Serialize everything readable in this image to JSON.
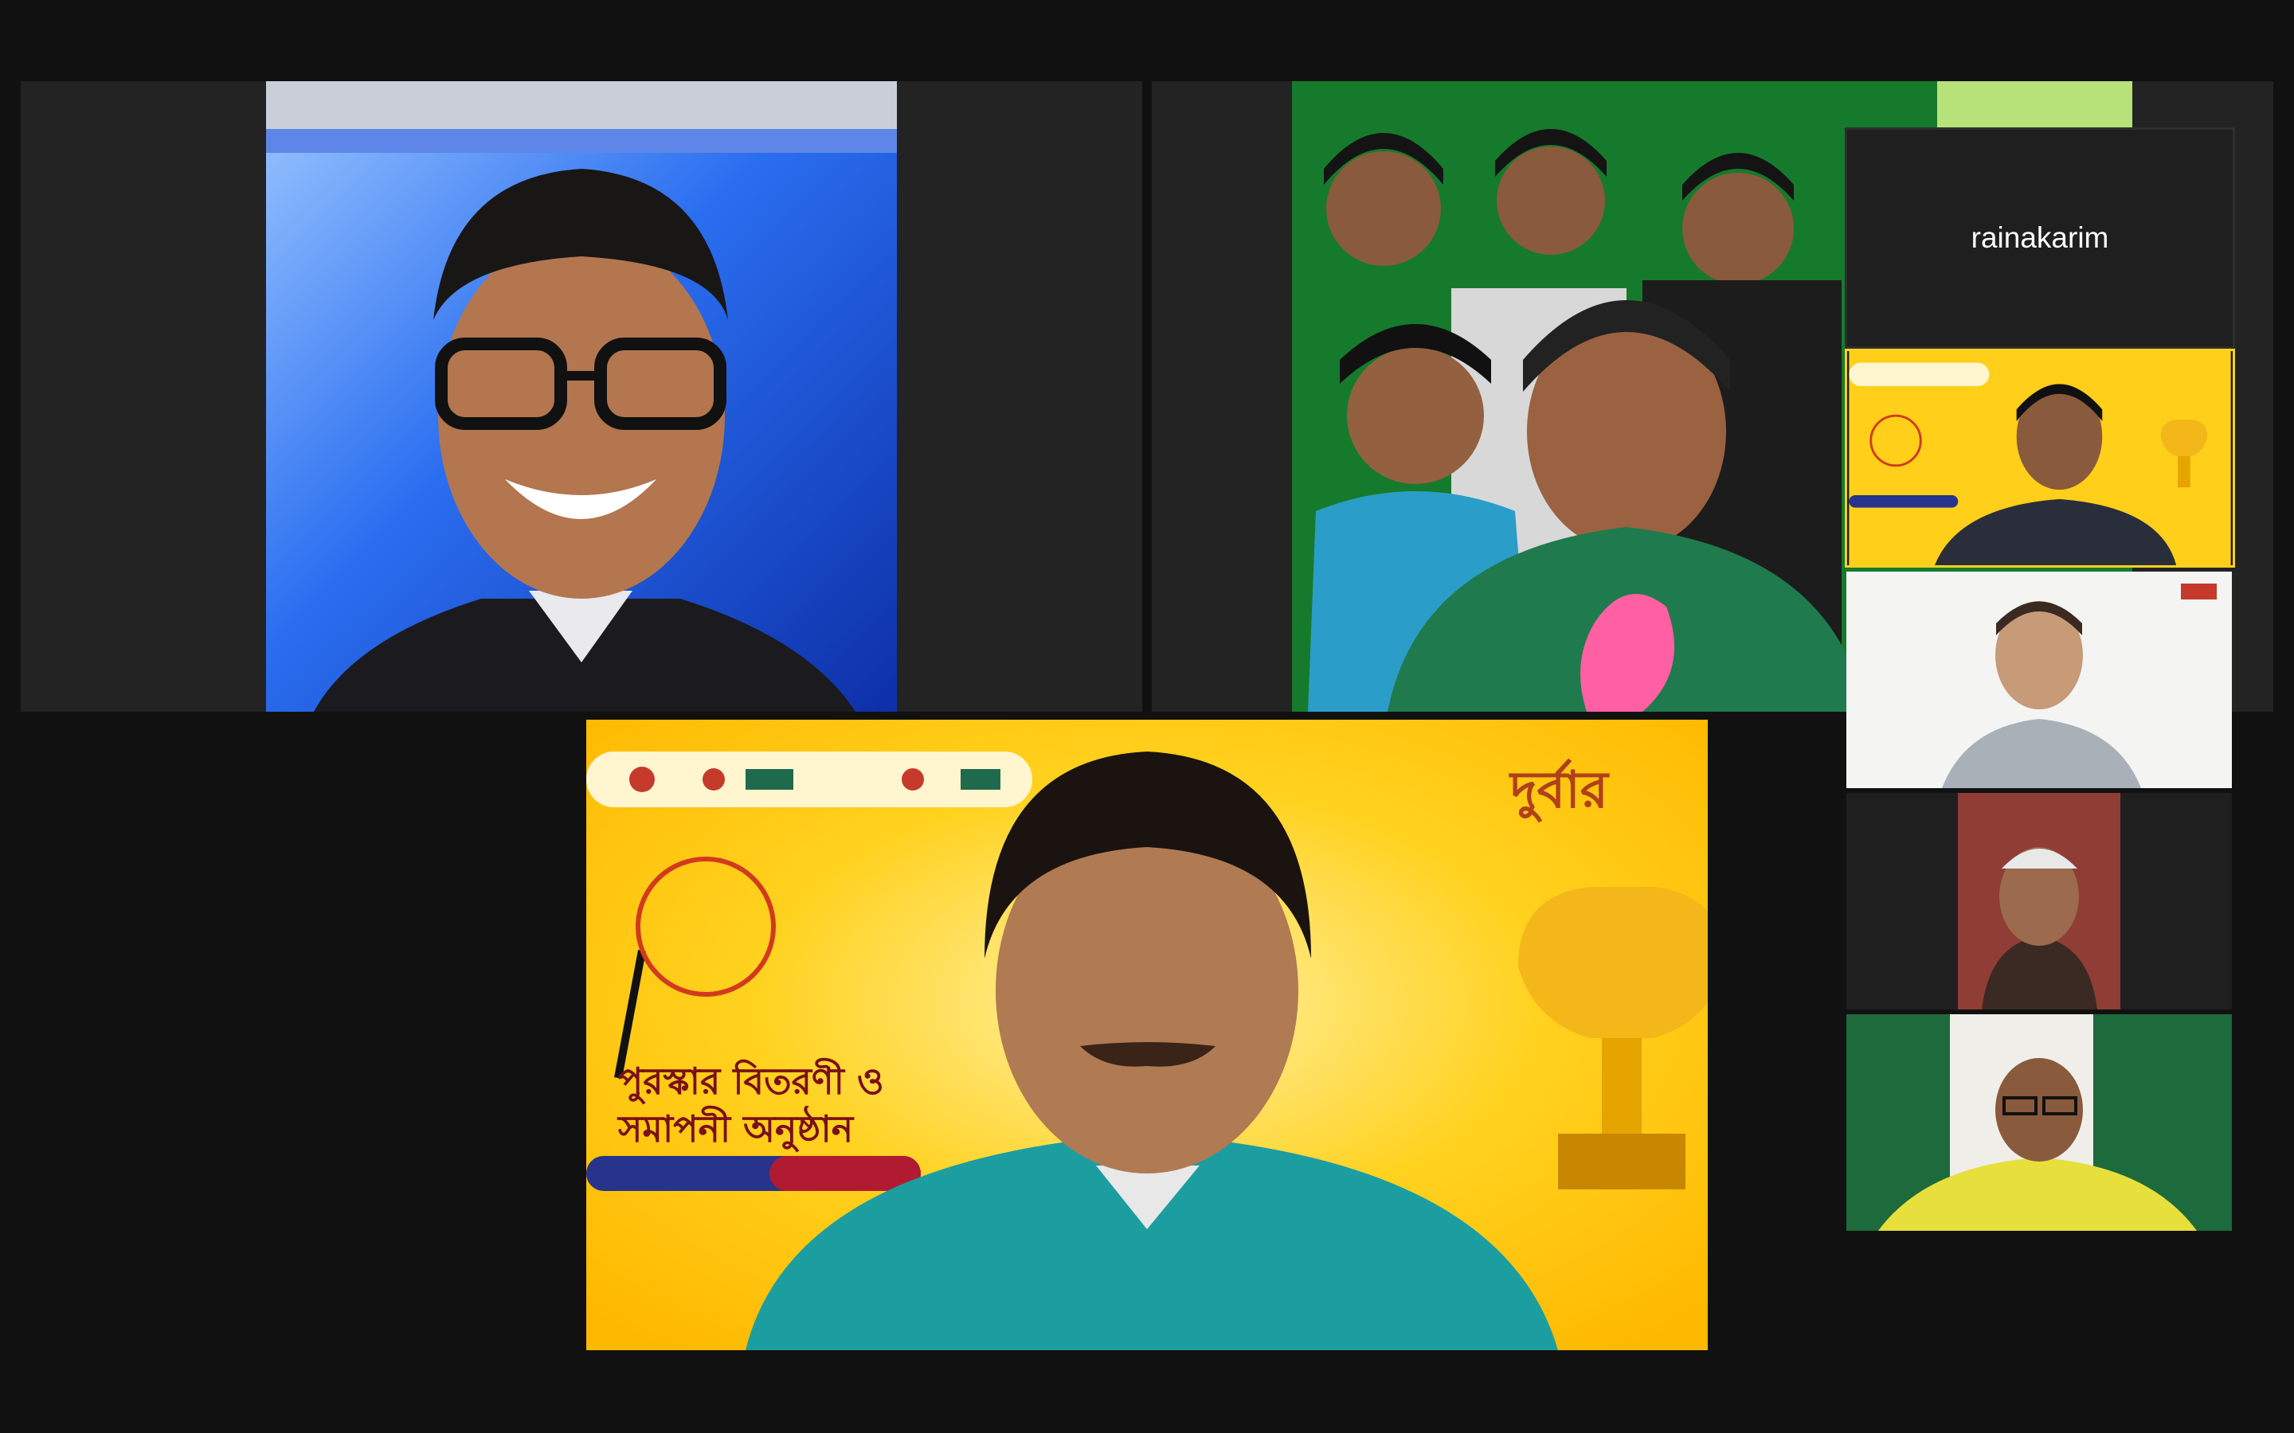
{
  "meeting": {
    "participants": [
      {
        "id": "p1",
        "label": "speaker-1",
        "background": "#1d4fd0"
      },
      {
        "id": "p2",
        "label": "group-video",
        "background": "#167a2c"
      },
      {
        "id": "p3",
        "label": "main-speaker",
        "background": "#ffcc12"
      },
      {
        "id": "p4",
        "name": "rainakarim"
      },
      {
        "id": "p5",
        "label": "thumb-speaker-yellow",
        "background": "#ffcf1a"
      },
      {
        "id": "p6",
        "label": "thumb-speaker-white",
        "background": "#f4f4f2"
      },
      {
        "id": "p7",
        "label": "thumb-speaker-red",
        "background": "#8f3d35"
      },
      {
        "id": "p8",
        "label": "thumb-speaker-green",
        "background": "#1d6a3c"
      }
    ],
    "rainakarim_label": "rainakarim"
  },
  "colors": {
    "app_bg": "#111111",
    "tile_bg": "#232323",
    "accent_yellow": "#ffc21a",
    "banner_red": "#8a0f1c"
  }
}
